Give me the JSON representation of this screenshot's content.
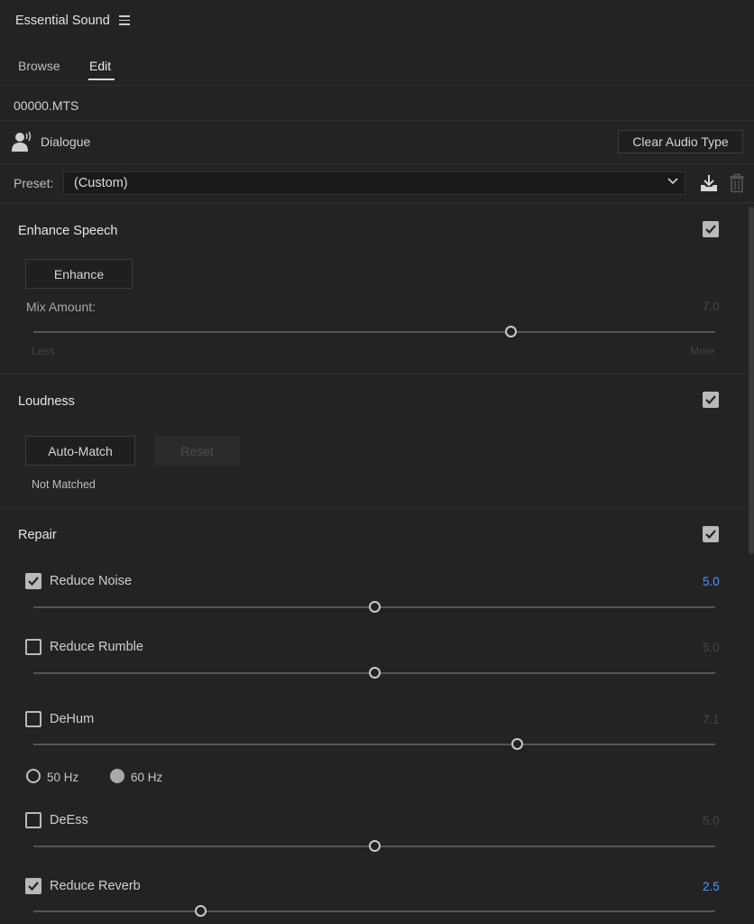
{
  "panel": {
    "title": "Essential Sound",
    "menu_icon": "hamburger-menu-icon"
  },
  "tabs": [
    {
      "label": "Browse",
      "active": false
    },
    {
      "label": "Edit",
      "active": true
    }
  ],
  "clip": {
    "name": "00000.MTS"
  },
  "audio_type": {
    "label": "Dialogue",
    "icon": "dialogue-speaker-icon",
    "clear_button": "Clear Audio Type"
  },
  "preset": {
    "label": "Preset:",
    "value": "(Custom)",
    "save_icon": "save-preset-icon",
    "delete_icon": "trash-icon"
  },
  "enhance_speech": {
    "title": "Enhance Speech",
    "enabled": true,
    "button": "Enhance",
    "mix_label": "Mix Amount:",
    "mix_value": "7.0",
    "min_label": "Less",
    "max_label": "More",
    "slider_fraction": 0.7
  },
  "loudness": {
    "title": "Loudness",
    "enabled": true,
    "auto_match": "Auto-Match",
    "reset": "Reset",
    "status": "Not Matched"
  },
  "repair": {
    "title": "Repair",
    "enabled": true,
    "items": [
      {
        "label": "Reduce Noise",
        "checked": true,
        "value": "5.0",
        "fraction": 0.5
      },
      {
        "label": "Reduce Rumble",
        "checked": false,
        "value": "5.0",
        "fraction": 0.5
      },
      {
        "label": "DeHum",
        "checked": false,
        "value": "7.1",
        "fraction": 0.71
      },
      {
        "label": "DeEss",
        "checked": false,
        "value": "5.0",
        "fraction": 0.5
      },
      {
        "label": "Reduce Reverb",
        "checked": true,
        "value": "2.5",
        "fraction": 0.245
      }
    ],
    "dehum_options": [
      {
        "label": "50 Hz",
        "selected": false
      },
      {
        "label": "60 Hz",
        "selected": true
      }
    ]
  },
  "colors": {
    "accent_value": "#4a9cff",
    "background": "#232323"
  }
}
